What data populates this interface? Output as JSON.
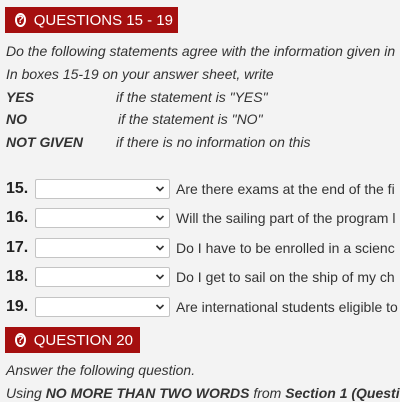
{
  "section1": {
    "header": "QUESTIONS 15 - 19",
    "instruction1": "Do the following statements agree with the information given in",
    "instruction2": "In boxes 15-19 on your answer sheet, write",
    "legend": [
      {
        "term": "YES",
        "desc": "if the statement is \"YES\""
      },
      {
        "term": "NO",
        "desc": "if the statement is \"NO\""
      },
      {
        "term": "NOT GIVEN",
        "desc": "if there is no information on this"
      }
    ],
    "questions": [
      {
        "number": "15.",
        "text": "Are there exams at the end of the fi"
      },
      {
        "number": "16.",
        "text": "Will the sailing part of the program l"
      },
      {
        "number": "17.",
        "text": "Do I have to be enrolled in a scienc"
      },
      {
        "number": "18.",
        "text": "Do I get to sail on the ship of my ch"
      },
      {
        "number": "19.",
        "text": "Are international students eligible to"
      }
    ]
  },
  "section2": {
    "header": "QUESTION 20",
    "instruction1": "Answer the following question.",
    "instruction2_prefix": "Using ",
    "instruction2_bold": "NO MORE THAN TWO WORDS",
    "instruction2_mid": " from ",
    "instruction2_bold2": "Section 1 (Questi"
  },
  "colors": {
    "header_bg": "#a50f0f",
    "page_bg": "#f3f3f3"
  },
  "icons": {
    "header_icon": "question-circle-icon",
    "select_icon": "chevron-down-icon"
  }
}
